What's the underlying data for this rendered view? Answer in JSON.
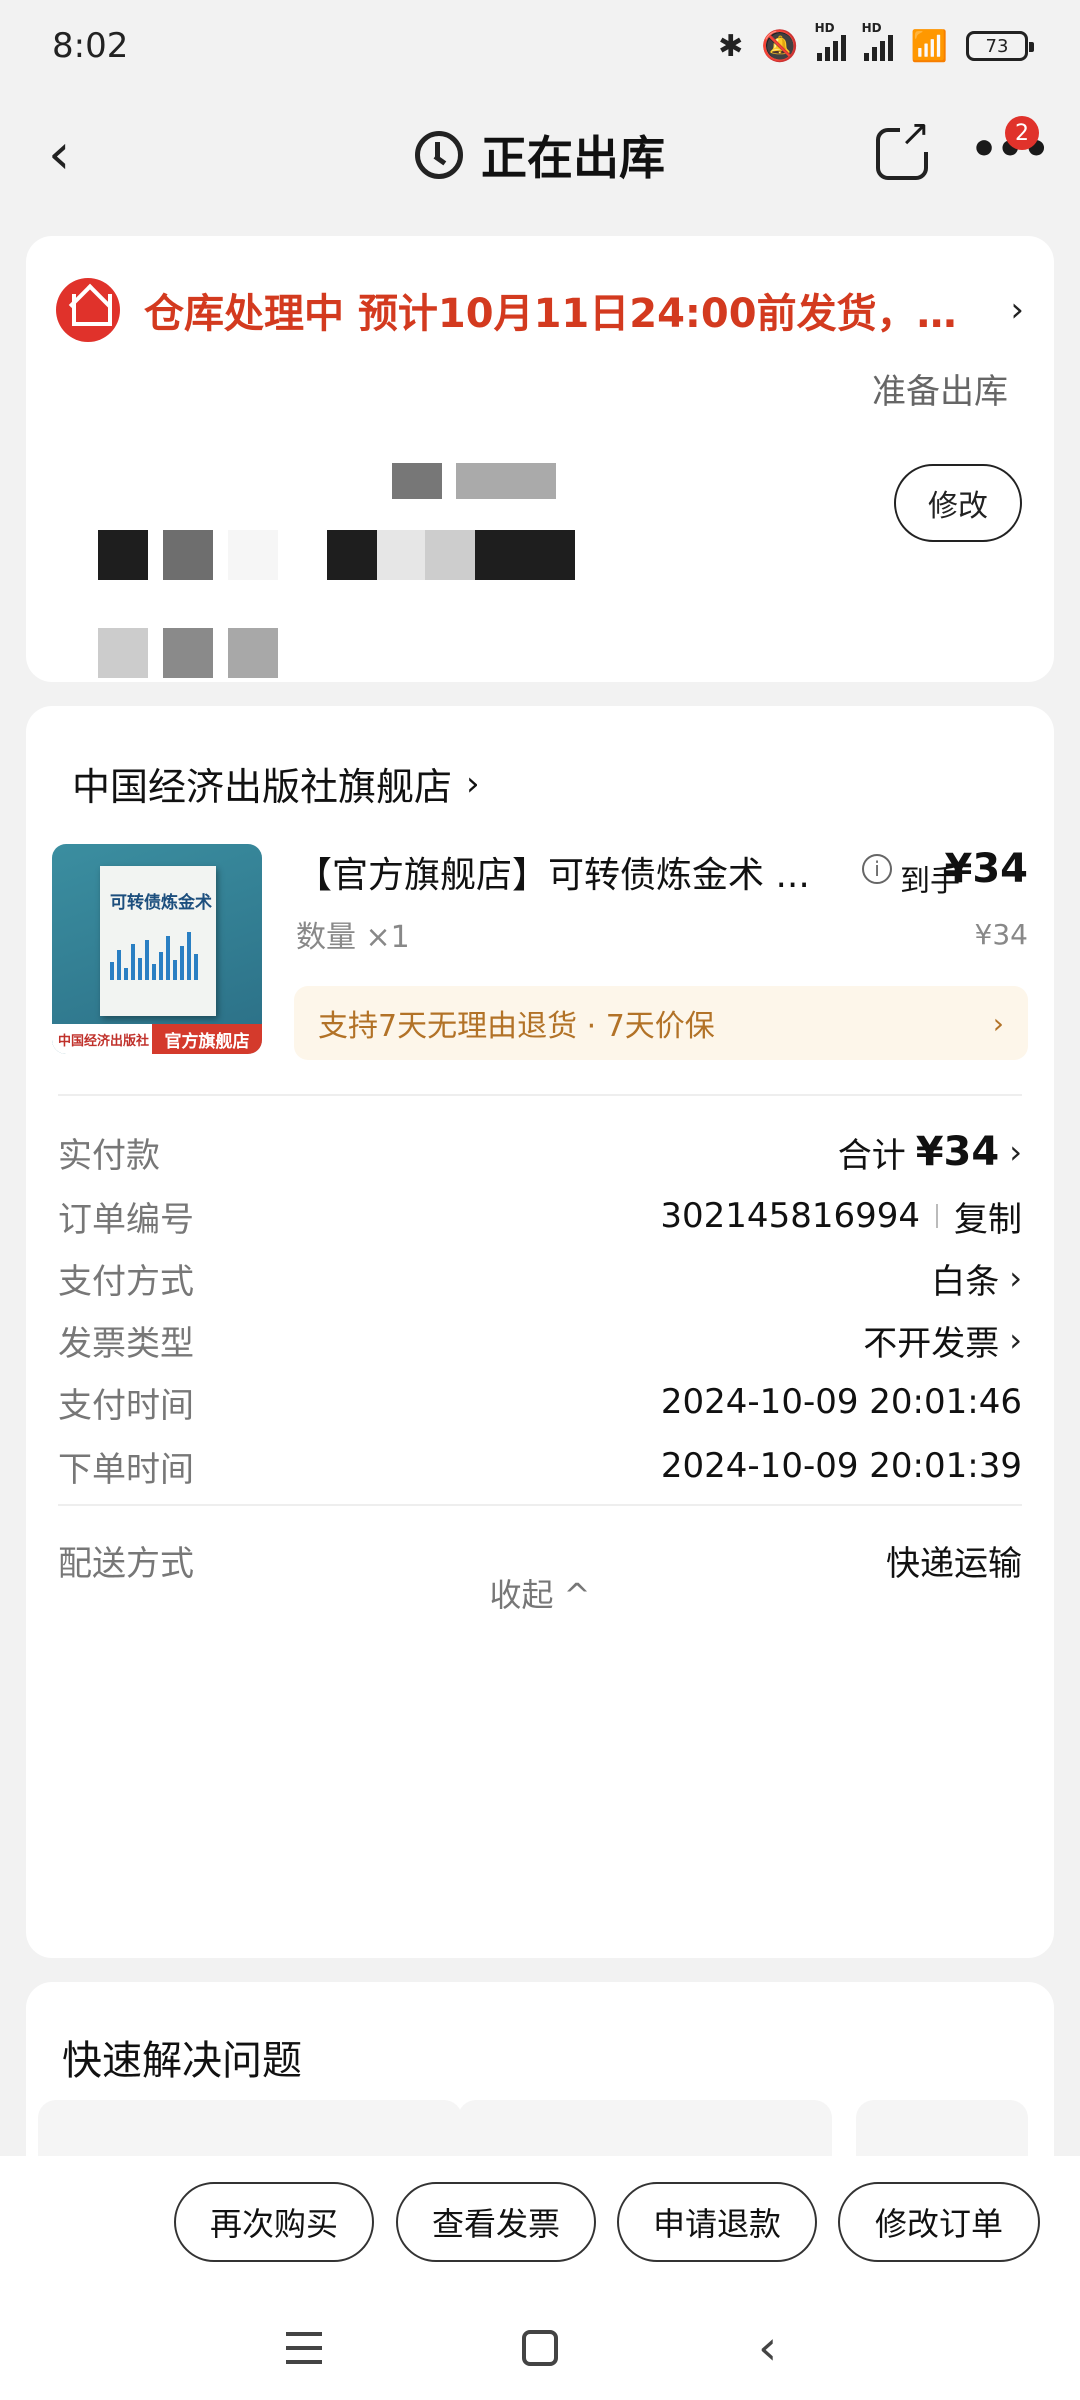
{
  "status_bar": {
    "time": "8:02",
    "battery": "73"
  },
  "nav": {
    "title": "正在出库",
    "badge_count": "2"
  },
  "status_card": {
    "status": "仓库处理中",
    "eta": "预计10月11日24:00前发货，1...",
    "prep_text": "准备出库",
    "edit_label": "修改"
  },
  "order": {
    "store_name": "中国经济出版社旗舰店",
    "product": {
      "image_title": "可转债炼金术",
      "image_publisher": "中国经济出版社",
      "image_badge": "官方旗舰店",
      "name": "【官方旗舰店】可转债炼金术 ...",
      "final_price_label": "到手",
      "final_price": "¥34",
      "quantity": "数量 ×1",
      "unit_price": "¥34",
      "guarantee": "支持7天无理由退货 · 7天价保"
    },
    "details": [
      {
        "label": "实付款",
        "value_prefix": "合计",
        "value": "¥34"
      },
      {
        "label": "订单编号",
        "value": "302145816994",
        "action": "复制"
      },
      {
        "label": "支付方式",
        "value": "白条"
      },
      {
        "label": "发票类型",
        "value": "不开发票"
      },
      {
        "label": "支付时间",
        "value": "2024-10-09 20:01:46"
      },
      {
        "label": "下单时间",
        "value": "2024-10-09 20:01:39"
      },
      {
        "label": "配送方式",
        "value": "快递运输"
      }
    ],
    "collapse_label": "收起 ^"
  },
  "quick": {
    "title": "快速解决问题"
  },
  "actions": [
    "再次购买",
    "查看发票",
    "申请退款",
    "修改订单"
  ],
  "colors": {
    "accent_red": "#e0322b",
    "status_text": "#d33a1f",
    "guarantee_text": "#b27227"
  }
}
